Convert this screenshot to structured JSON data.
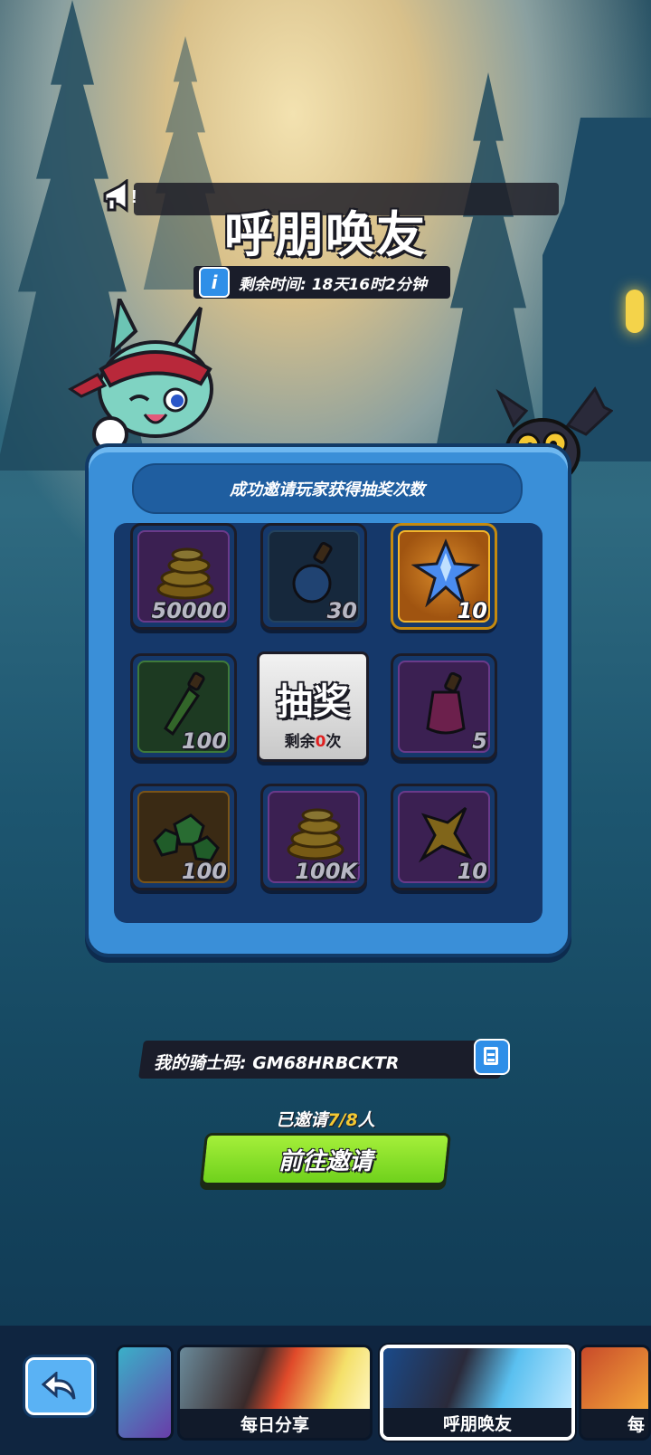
{
  "header": {
    "title": "呼朋唤友",
    "timer_label": "剩余时间: 18天16时2分钟",
    "info_glyph": "i"
  },
  "panel": {
    "banner": "成功邀请玩家获得抽奖次数",
    "rewards": [
      {
        "icon": "gold-coins-icon",
        "qty": "50000"
      },
      {
        "icon": "blue-potion-icon",
        "qty": "30"
      },
      {
        "icon": "blue-crystal-icon",
        "qty": "10"
      },
      {
        "icon": "green-vial-icon",
        "qty": "100"
      },
      {
        "icon": "purple-potion-icon",
        "qty": "5"
      },
      {
        "icon": "green-gems-icon",
        "qty": "100"
      },
      {
        "icon": "gold-coins-icon",
        "qty": "100K"
      },
      {
        "icon": "gold-star-icon",
        "qty": "10"
      }
    ],
    "draw_button": {
      "title": "抽奖",
      "remain_prefix": "剩余",
      "remain_count": "0",
      "remain_suffix": "次"
    }
  },
  "knight_code": {
    "label": "我的骑士码: GM68HRBCKTR"
  },
  "invite": {
    "prefix": "已邀请",
    "count": "7/8",
    "suffix": "人",
    "button": "前往邀请"
  },
  "bottom_tabs": [
    {
      "label": "每日分享",
      "active": false
    },
    {
      "label": "呼朋唤友",
      "active": true
    },
    {
      "label": "每",
      "active": false
    }
  ],
  "colors": {
    "panel_blue": "#3a8fd8",
    "invite_green": "#8be02a",
    "highlight_yellow": "#f4c832",
    "zero_red": "#e02020"
  }
}
